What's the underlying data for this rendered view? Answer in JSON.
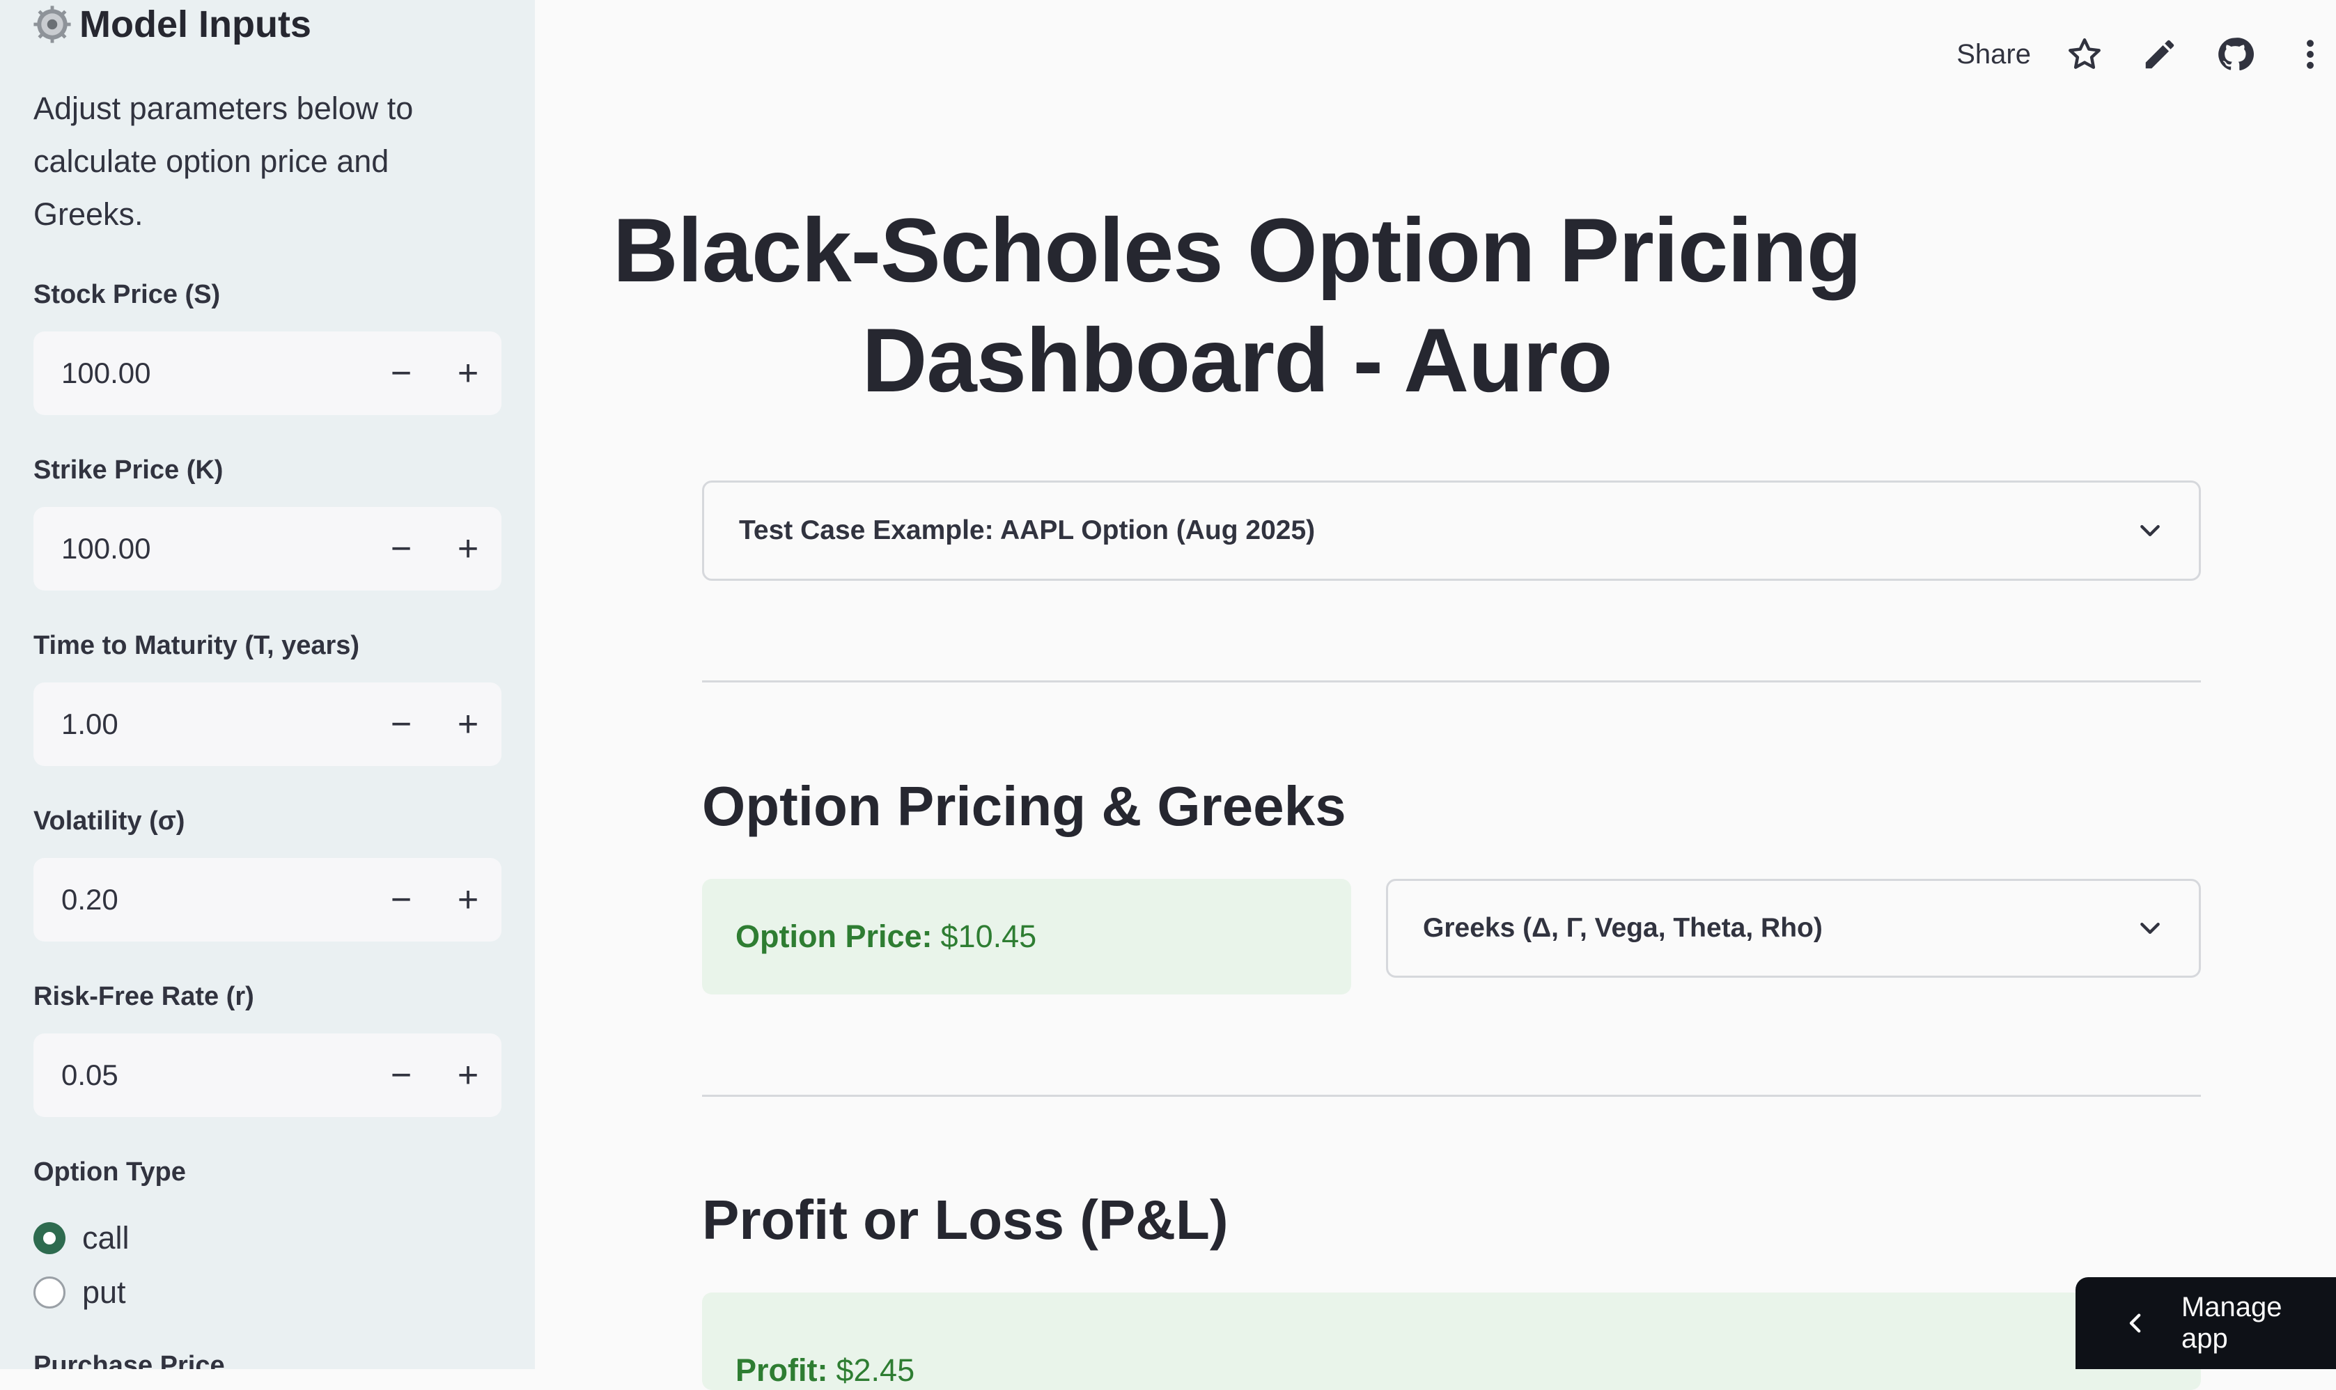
{
  "sidebar": {
    "title": "Model Inputs",
    "description": "Adjust parameters below to calculate option price and Greeks.",
    "fields": [
      {
        "label": "Stock Price (S)",
        "value": "100.00"
      },
      {
        "label": "Strike Price (K)",
        "value": "100.00"
      },
      {
        "label": "Time to Maturity (T, years)",
        "value": "1.00"
      },
      {
        "label": "Volatility (σ)",
        "value": "0.20"
      },
      {
        "label": "Risk-Free Rate (r)",
        "value": "0.05"
      }
    ],
    "stepper": {
      "minus": "−",
      "plus": "+"
    },
    "option_type": {
      "label": "Option Type",
      "options": [
        "call",
        "put"
      ],
      "selected": "call"
    },
    "next_label_cut": "Purchase Price"
  },
  "toolbar": {
    "share_label": "Share",
    "icons": [
      "star-icon",
      "edit-icon",
      "github-icon",
      "more-vertical-icon"
    ]
  },
  "main": {
    "title": "Black-Scholes Option Pricing Dashboard - Auro",
    "test_case_expander": "Test Case Example: AAPL Option (Aug 2025)",
    "pricing_section": {
      "heading": "Option Pricing & Greeks",
      "price_label": "Option Price:",
      "price_value": "$10.45",
      "greeks_expander": "Greeks (Δ, Γ, Vega, Theta, Rho)"
    },
    "pnl_section": {
      "heading": "Profit or Loss (P&L)",
      "profit_label": "Profit:",
      "profit_value": "$2.45"
    }
  },
  "manage_app": {
    "label": "Manage app"
  },
  "colors": {
    "sidebar_bg": "#eaf0f2",
    "accent_green": "#2e7d32",
    "metric_bg": "#e9f4ea",
    "radio_selected": "#2e6b4f"
  }
}
